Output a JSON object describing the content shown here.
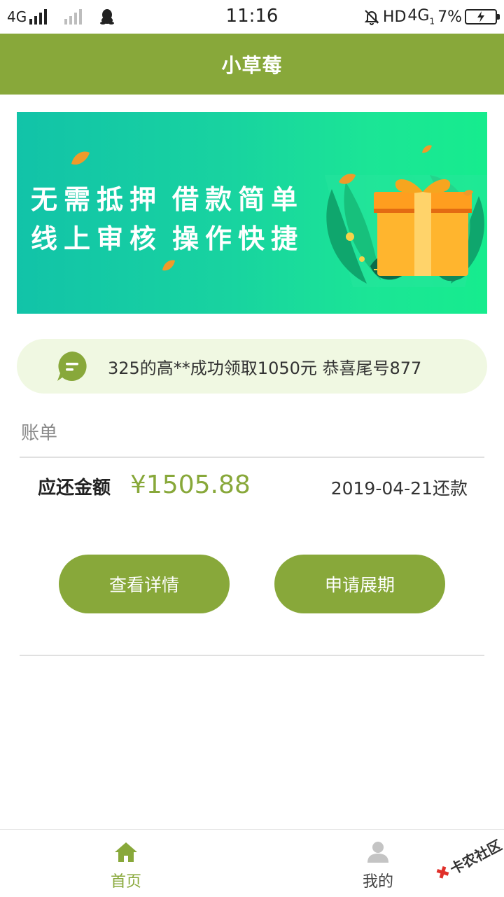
{
  "status_bar": {
    "network_left": "4G",
    "time": "11:16",
    "hd": "HD",
    "network_right": "4G",
    "network_right_sub": "1",
    "battery": "7%"
  },
  "header": {
    "title": "小草莓"
  },
  "banner": {
    "line1_a": "无需抵押",
    "line1_b": "借款简单",
    "line2_a": "线上审核",
    "line2_b": "操作快捷"
  },
  "notice": {
    "text": "325的高**成功领取1050元 恭喜尾号877"
  },
  "bill": {
    "section_title": "账单",
    "amount_label": "应还金额",
    "amount": "¥1505.88",
    "due": "2019-04-21还款",
    "detail_button": "查看详情",
    "extend_button": "申请展期"
  },
  "tabbar": {
    "home": "首页",
    "mine": "我的"
  },
  "colors": {
    "brand": "#88a83a",
    "notice_bg": "#f0f8e2",
    "banner_start": "#12c3a8",
    "banner_end": "#16ec8e"
  },
  "watermark": {
    "text": "卡农社区"
  }
}
